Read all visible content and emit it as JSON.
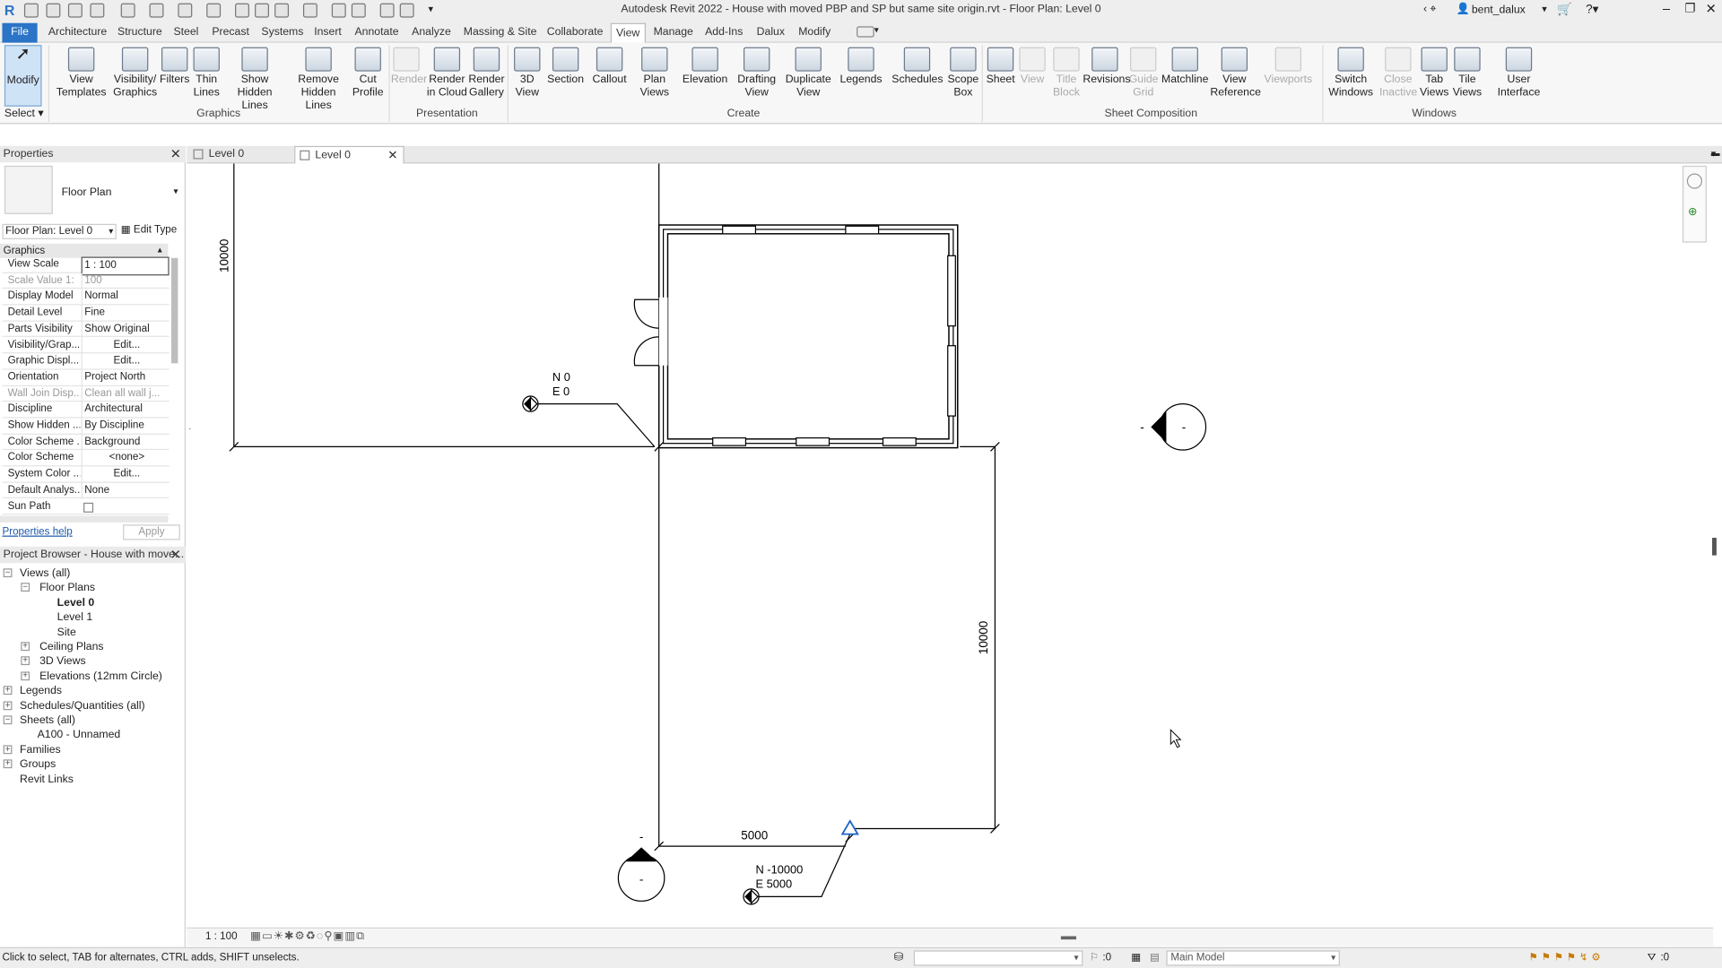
{
  "app": {
    "window_title": "Autodesk Revit 2022 - House with moved PBP and SP but same site origin.rvt - Floor Plan: Level 0",
    "user": "bent_dalux"
  },
  "menu": {
    "tabs": [
      "File",
      "Architecture",
      "Structure",
      "Steel",
      "Precast",
      "Systems",
      "Insert",
      "Annotate",
      "Analyze",
      "Massing & Site",
      "Collaborate",
      "View",
      "Manage",
      "Add-Ins",
      "Dalux",
      "Modify"
    ],
    "active": "View"
  },
  "ribbon": {
    "select_label": "Select",
    "buttons": {
      "modify": "Modify",
      "view_templates": "View Templates",
      "visibility_graphics": "Visibility/ Graphics",
      "filters": "Filters",
      "thin_lines": "Thin Lines",
      "show_hidden_lines": "Show Hidden Lines",
      "remove_hidden_lines": "Remove Hidden Lines",
      "cut_profile": "Cut Profile",
      "render": "Render",
      "render_in_cloud": "Render in Cloud",
      "render_gallery": "Render Gallery",
      "view_3d": "3D View",
      "section": "Section",
      "callout": "Callout",
      "plan_views": "Plan Views",
      "elevation": "Elevation",
      "drafting_view": "Drafting View",
      "duplicate_view": "Duplicate View",
      "legends": "Legends",
      "schedules": "Schedules",
      "scope_box": "Scope Box",
      "sheet": "Sheet",
      "view": "View",
      "title_block": "Title Block",
      "revisions": "Revisions",
      "guide_grid": "Guide Grid",
      "matchline": "Matchline",
      "view_reference": "View Reference",
      "viewports": "Viewports",
      "switch_windows": "Switch Windows",
      "close_inactive": "Close Inactive",
      "tab_views": "Tab Views",
      "tile_views": "Tile Views",
      "user_interface": "User Interface"
    },
    "panels": {
      "graphics": "Graphics",
      "presentation": "Presentation",
      "create": "Create",
      "sheet_composition": "Sheet Composition",
      "windows": "Windows"
    }
  },
  "properties": {
    "title": "Properties",
    "type_name": "Floor Plan",
    "instance_selector": "Floor Plan: Level 0",
    "edit_type": "Edit Type",
    "group": "Graphics",
    "rows": [
      {
        "k": "View Scale",
        "v": "1 : 100"
      },
      {
        "k": "Scale Value    1:",
        "v": "100"
      },
      {
        "k": "Display Model",
        "v": "Normal"
      },
      {
        "k": "Detail Level",
        "v": "Fine"
      },
      {
        "k": "Parts Visibility",
        "v": "Show Original"
      },
      {
        "k": "Visibility/Grap...",
        "v": "Edit..."
      },
      {
        "k": "Graphic Displ...",
        "v": "Edit..."
      },
      {
        "k": "Orientation",
        "v": "Project North"
      },
      {
        "k": "Wall Join Disp...",
        "v": "Clean all wall j..."
      },
      {
        "k": "Discipline",
        "v": "Architectural"
      },
      {
        "k": "Show Hidden ...",
        "v": "By Discipline"
      },
      {
        "k": "Color Scheme ...",
        "v": "Background"
      },
      {
        "k": "Color Scheme",
        "v": "<none>"
      },
      {
        "k": "System Color ...",
        "v": "Edit..."
      },
      {
        "k": "Default Analys...",
        "v": "None"
      },
      {
        "k": "Sun Path",
        "v": ""
      }
    ],
    "help_link": "Properties help",
    "apply": "Apply"
  },
  "browser": {
    "title": "Project Browser - House with move...",
    "items": [
      {
        "label": "Views (all)",
        "level": 0,
        "bold": false
      },
      {
        "label": "Floor Plans",
        "level": 1,
        "bold": false
      },
      {
        "label": "Level 0",
        "level": 2,
        "bold": true
      },
      {
        "label": "Level 1",
        "level": 2,
        "bold": false
      },
      {
        "label": "Site",
        "level": 2,
        "bold": false
      },
      {
        "label": "Ceiling Plans",
        "level": 1,
        "bold": false
      },
      {
        "label": "3D Views",
        "level": 1,
        "bold": false
      },
      {
        "label": "Elevations (12mm Circle)",
        "level": 1,
        "bold": false
      },
      {
        "label": "Legends",
        "level": 0,
        "bold": false
      },
      {
        "label": "Schedules/Quantities (all)",
        "level": 0,
        "bold": false
      },
      {
        "label": "Sheets (all)",
        "level": 0,
        "bold": false
      },
      {
        "label": "A100 - Unnamed",
        "level": 1,
        "bold": false
      },
      {
        "label": "Families",
        "level": 0,
        "bold": false
      },
      {
        "label": "Groups",
        "level": 0,
        "bold": false
      },
      {
        "label": "Revit Links",
        "level": 0,
        "bold": false
      }
    ]
  },
  "view_tabs": [
    "Level 0",
    "Level 0"
  ],
  "drawing": {
    "dim_left": "10000",
    "dim_right": "10000",
    "dim_bottom": "5000",
    "pbp_n": "N 0",
    "pbp_e": "E 0",
    "sp_n": "N -10000",
    "sp_e": "E 5000",
    "marker": "-"
  },
  "view_control": {
    "scale": "1 : 100"
  },
  "status": {
    "message": "Click to select, TAB for alternates, CTRL adds, SHIFT unselects.",
    "count": ":0",
    "model": "Main Model",
    "filter_count": ":0"
  }
}
